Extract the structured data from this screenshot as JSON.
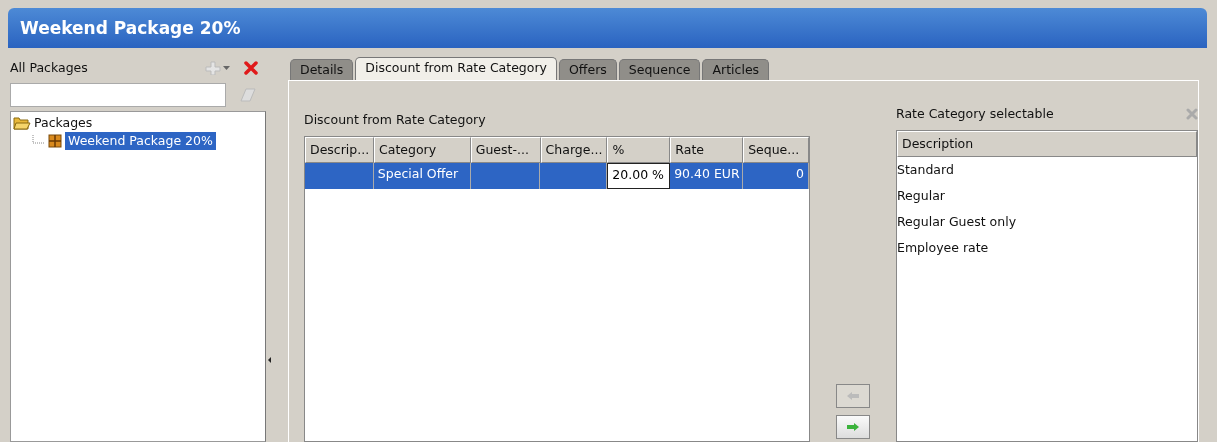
{
  "window": {
    "title": "Weekend Package 20%"
  },
  "left_panel": {
    "title": "All Packages",
    "tree": [
      {
        "label": "Packages",
        "expanded": true,
        "selected": false,
        "children": [
          {
            "label": "Weekend Package 20%",
            "selected": true
          }
        ]
      }
    ]
  },
  "tabs": [
    {
      "label": "Details",
      "selected": false
    },
    {
      "label": "Discount from Rate Category",
      "selected": true
    },
    {
      "label": "Offers",
      "selected": false
    },
    {
      "label": "Sequence",
      "selected": false
    },
    {
      "label": "Articles",
      "selected": false
    }
  ],
  "discount_table": {
    "title": "Discount from Rate Category",
    "columns": [
      "Descrip...",
      "Category",
      "Guest-...",
      "Charge...",
      "%",
      "Rate",
      "Seque..."
    ],
    "rows": [
      {
        "selected": true,
        "cells": [
          {
            "text": "",
            "editing": false
          },
          {
            "text": "Special Offer",
            "editing": false
          },
          {
            "text": "",
            "editing": false
          },
          {
            "text": "",
            "editing": false
          },
          {
            "text": "20.00 %",
            "editing": true
          },
          {
            "text": "90.40 EUR",
            "editing": false
          },
          {
            "text": "0",
            "editing": false
          }
        ]
      }
    ]
  },
  "move_buttons": [
    {
      "kind": "left",
      "disabled": true
    },
    {
      "kind": "right",
      "disabled": false
    }
  ],
  "selectable_table": {
    "title": "Rate Category selectable",
    "columns": [
      "Description"
    ],
    "rows": [
      "Standard",
      "Regular",
      "Regular Guest only",
      "Employee rate"
    ]
  }
}
